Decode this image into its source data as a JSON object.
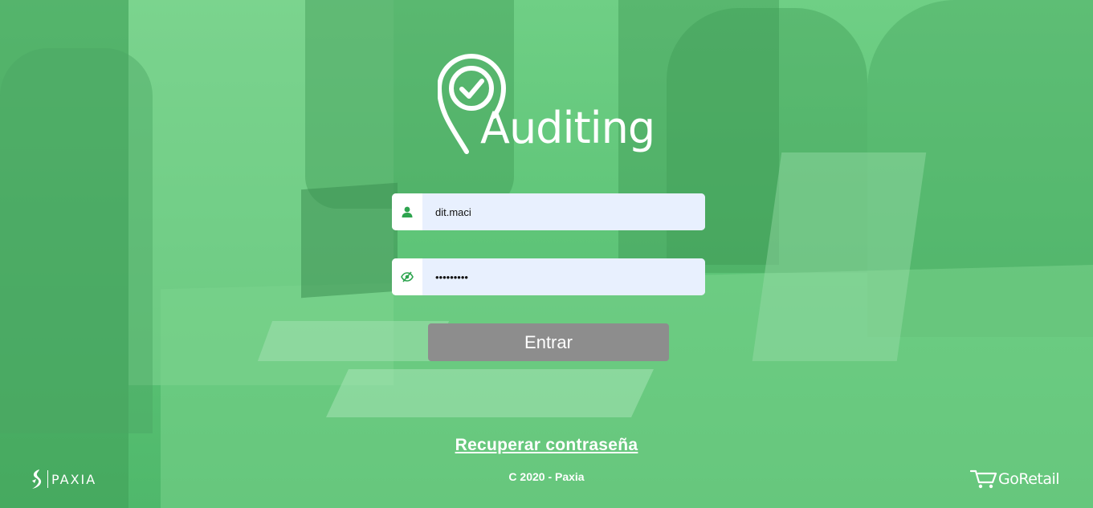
{
  "app": {
    "logo_text": "Auditing"
  },
  "login": {
    "username_value": "dit.maci",
    "password_value": "password1",
    "submit_label": "Entrar"
  },
  "links": {
    "recover": "Recuperar contraseña"
  },
  "footer": {
    "copyright": "C 2020 - Paxia",
    "left_brand": "PAXIA",
    "right_brand": "GoRetail"
  },
  "colors": {
    "overlay_green": "#5fc57a",
    "icon_green": "#2ea44f",
    "input_bg": "#e8f0fe",
    "button_bg": "#8d8d8d"
  },
  "icons": [
    "user-icon",
    "eye-icon",
    "location-check-icon",
    "paxia-logo-icon",
    "cart-icon"
  ]
}
